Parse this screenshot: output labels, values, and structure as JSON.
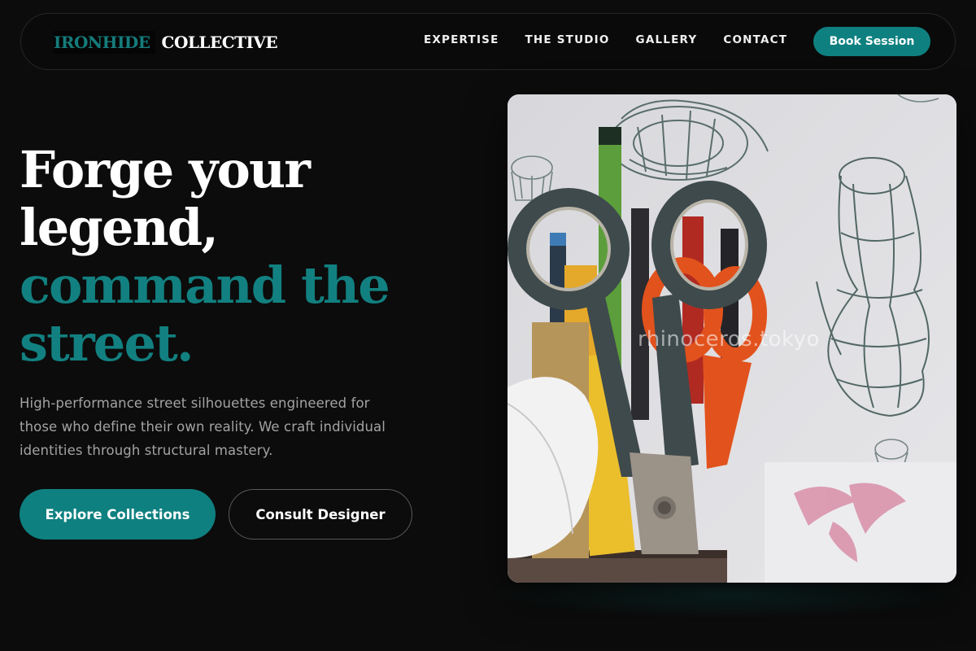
{
  "brand": {
    "part1": "IRONHIDE",
    "part2": "COLLECTIVE"
  },
  "nav": {
    "links": [
      "EXPERTISE",
      "THE STUDIO",
      "GALLERY",
      "CONTACT"
    ],
    "cta": "Book Session"
  },
  "hero": {
    "headline_line1": "Forge your",
    "headline_line2": "legend,",
    "headline_line3": "command the",
    "headline_line4": "street.",
    "description": "High-performance street silhouettes engineered for those who define their own reality. We craft individual identities through structural mastery.",
    "primary_button": "Explore Collections",
    "secondary_button": "Consult Designer",
    "image_watermark": "rhinoceros.tokyo"
  },
  "colors": {
    "background": "#0c0c0c",
    "accent": "#0f8080",
    "text_muted": "#a3a3a3"
  },
  "icons": {
    "hero_image": "scissors-pencil-cup-photo"
  }
}
